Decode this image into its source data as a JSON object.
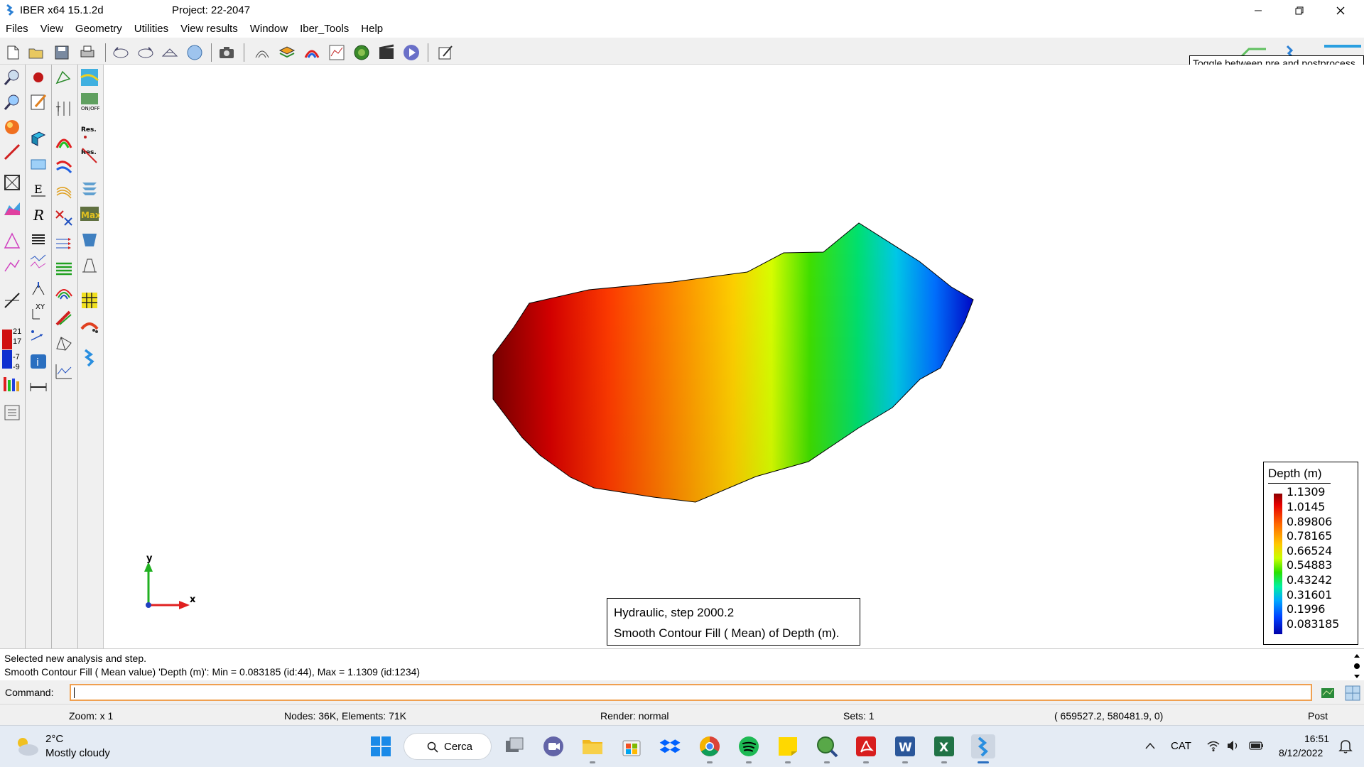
{
  "window": {
    "app_name": "IBER x64 15.1.2d",
    "project": "Project: 22-2047"
  },
  "menu": [
    "Files",
    "View",
    "Geometry",
    "Utilities",
    "View results",
    "Window",
    "Iber_Tools",
    "Help"
  ],
  "tooltip": "Toggle between pre and postprocess",
  "palette": {
    "legend_numbers": [
      "21",
      "17",
      "-7",
      "-9"
    ]
  },
  "axes": {
    "x": "x",
    "y": "y"
  },
  "legend": {
    "title": "Depth (m)",
    "values": [
      "1.1309",
      "1.0145",
      "0.89806",
      "0.78165",
      "0.66524",
      "0.54883",
      "0.43242",
      "0.31601",
      "0.1996",
      "0.083185"
    ]
  },
  "infobox": {
    "line1": "Hydraulic, step 2000.2",
    "line2": "Smooth Contour Fill ( Mean) of Depth (m)."
  },
  "messages": {
    "line1": "Selected new analysis and step.",
    "line2": "Smooth Contour Fill ( Mean value) 'Depth (m)': Min = 0.083185 (id:44), Max = 1.1309 (id:1234)"
  },
  "command": {
    "label": "Command:",
    "value": ""
  },
  "status": {
    "zoom": "Zoom: x 1",
    "nodes": "Nodes: 36K, Elements: 71K",
    "render": "Render: normal",
    "sets": "Sets: 1",
    "coords": "( 659527.2,  580481.9,  0)",
    "mode": "Post"
  },
  "taskbar": {
    "weather_temp": "2°C",
    "weather_desc": "Mostly cloudy",
    "search": "Cerca",
    "language": "CAT",
    "time": "16:51",
    "date": "8/12/2022"
  },
  "colors": {
    "accent_orange": "#f0a050",
    "ui_gray": "#f0f0f0",
    "taskbar": "#e4ebf4"
  }
}
